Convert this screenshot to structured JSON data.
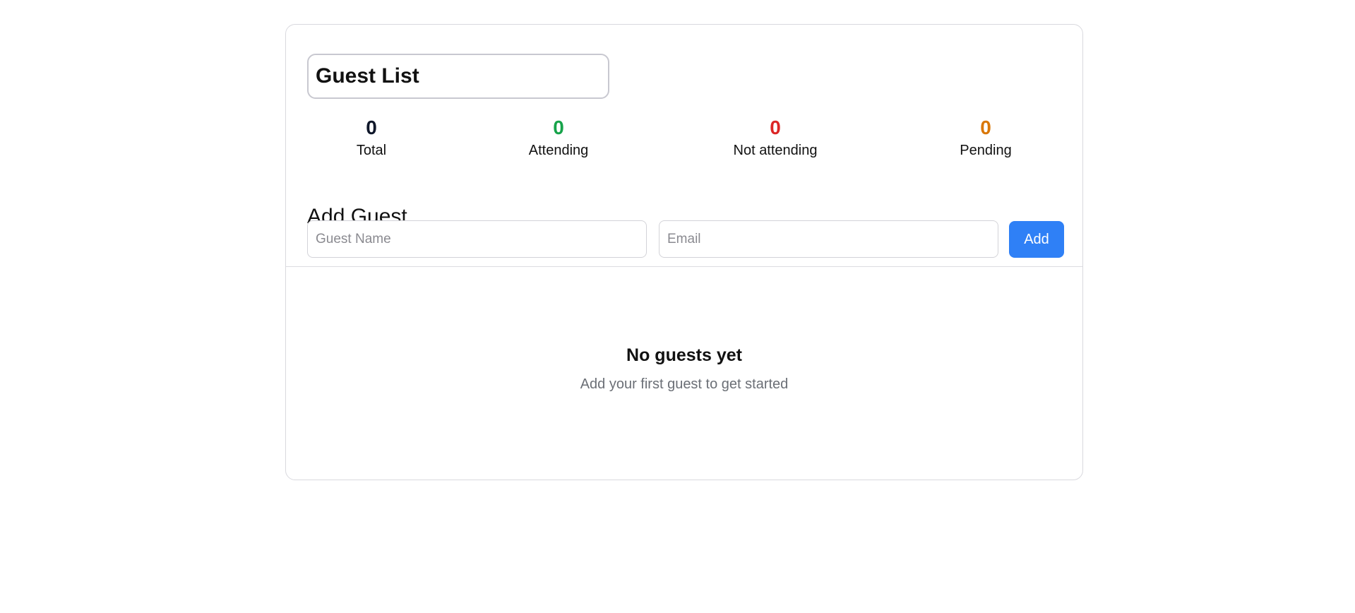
{
  "title": {
    "value": "Guest List"
  },
  "stats": [
    {
      "key": "total",
      "value": "0",
      "label": "Total",
      "color": "#0f172a"
    },
    {
      "key": "attending",
      "value": "0",
      "label": "Attending",
      "color": "#16a34a"
    },
    {
      "key": "not_attending",
      "value": "0",
      "label": "Not attending",
      "color": "#dc2626"
    },
    {
      "key": "pending",
      "value": "0",
      "label": "Pending",
      "color": "#d97706"
    }
  ],
  "add_guest": {
    "heading": "Add Guest",
    "name_placeholder": "Guest Name",
    "email_placeholder": "Email",
    "button_label": "Add",
    "button_color": "#2f80f6"
  },
  "empty_state": {
    "title": "No guests yet",
    "subtitle": "Add your first guest to get started"
  }
}
